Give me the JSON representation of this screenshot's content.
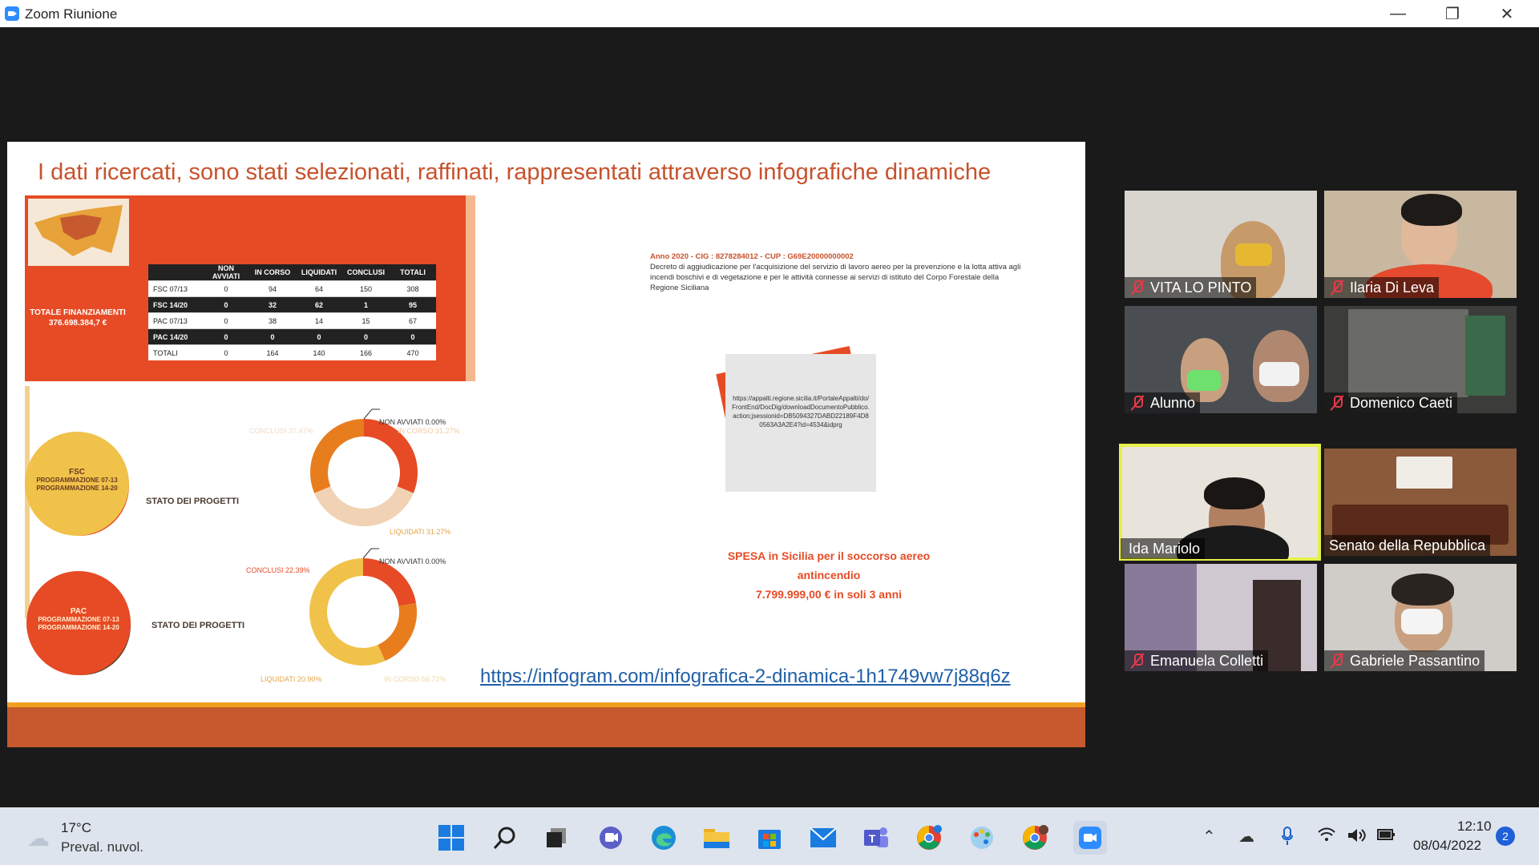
{
  "window": {
    "title": "Zoom Riunione"
  },
  "slide": {
    "title": "I dati  ricercati, sono stati selezionati, raffinati, rappresentati attraverso infografiche dinamiche",
    "totale_label": "TOTALE FINANZIAMENTI",
    "totale_value": "376.698.384,7 €",
    "table": {
      "headers": [
        "",
        "NON AVVIATI",
        "IN CORSO",
        "LIQUIDATI",
        "CONCLUSI",
        "TOTALI"
      ],
      "rows": [
        [
          "FSC 07/13",
          "0",
          "94",
          "64",
          "150",
          "308"
        ],
        [
          "FSC 14/20",
          "0",
          "32",
          "62",
          "1",
          "95"
        ],
        [
          "PAC 07/13",
          "0",
          "38",
          "14",
          "15",
          "67"
        ],
        [
          "PAC 14/20",
          "0",
          "0",
          "0",
          "0",
          "0"
        ],
        [
          "TOTALI",
          "0",
          "164",
          "140",
          "166",
          "470"
        ]
      ]
    },
    "fsc": {
      "circle_title": "FSC",
      "circle_sub1": "PROGRAMMAZIONE 07-13",
      "circle_sub2": "PROGRAMMAZIONE 14-20",
      "stato": "STATO DEI PROGETTI",
      "lbl_nonavviati": "NON AVVIATI 0.00%",
      "lbl_incorso": "IN CORSO 31.27%",
      "lbl_conclusi": "CONCLUSI 37.47%",
      "lbl_liquidati": "LIQUIDATI 31.27%"
    },
    "pac": {
      "circle_title": "PAC",
      "circle_sub1": "PROGRAMMAZIONE 07-13",
      "circle_sub2": "PROGRAMMAZIONE 14-20",
      "stato": "STATO DEI PROGETTI",
      "lbl_nonavviati": "NON AVVIATI 0.00%",
      "lbl_conclusi": "CONCLUSI 22.39%",
      "lbl_liquidati": "LIQUIDATI 20.90%",
      "lbl_incorso": "IN CORSO 56.72%"
    },
    "decree": {
      "head": "Anno 2020 - CIG : 8278284012 - CUP : G69E20000000002",
      "body": "Decreto di aggiudicazione per l'acquisizione del servizio di lavoro aereo per la prevenzione e la lotta attiva agli incendi boschivi e di vegetazione e per le attività connesse ai servizi di istituto del Corpo Forestale della Regione Siciliana"
    },
    "url_card": "https://appalti.regione.sicilia.it/PortaleAppalti/do/FrontEnd/DocDig/downloadDocumentoPubblico.action;jsessionid=DB5094327DABD22189F4D80563A3A2E4?id=4534&idprg",
    "spesa_line1": "SPESA in Sicilia per il soccorso aereo antincendio",
    "spesa_line2": "7.799.999,00 €  in soli 3 anni",
    "link": "https://infogram.com/infografica-2-dinamica-1h1749vw7j88q6z"
  },
  "participants": [
    {
      "name": "VITA LO PINTO",
      "muted": true
    },
    {
      "name": "Ilaria Di Leva",
      "muted": true
    },
    {
      "name": "Alunno",
      "muted": true
    },
    {
      "name": "Domenico Caeti",
      "muted": true
    },
    {
      "name": "Ida Mariolo",
      "muted": false
    },
    {
      "name": "Senato della Repubblica",
      "muted": false
    },
    {
      "name": "Emanuela Colletti",
      "muted": true
    },
    {
      "name": "Gabriele Passantino",
      "muted": true
    }
  ],
  "taskbar": {
    "temp": "17°C",
    "weather": "Preval. nuvol.",
    "time": "12:10",
    "date": "08/04/2022",
    "notifications": "2"
  },
  "chart_data": [
    {
      "type": "pie",
      "title": "FSC",
      "categories": [
        "NON AVVIATI",
        "IN CORSO",
        "CONCLUSI",
        "LIQUIDATI"
      ],
      "values": [
        0.0,
        31.27,
        37.47,
        31.27
      ]
    },
    {
      "type": "pie",
      "title": "PAC",
      "categories": [
        "NON AVVIATI",
        "CONCLUSI",
        "LIQUIDATI",
        "IN CORSO"
      ],
      "values": [
        0.0,
        22.39,
        20.9,
        56.72
      ]
    }
  ]
}
